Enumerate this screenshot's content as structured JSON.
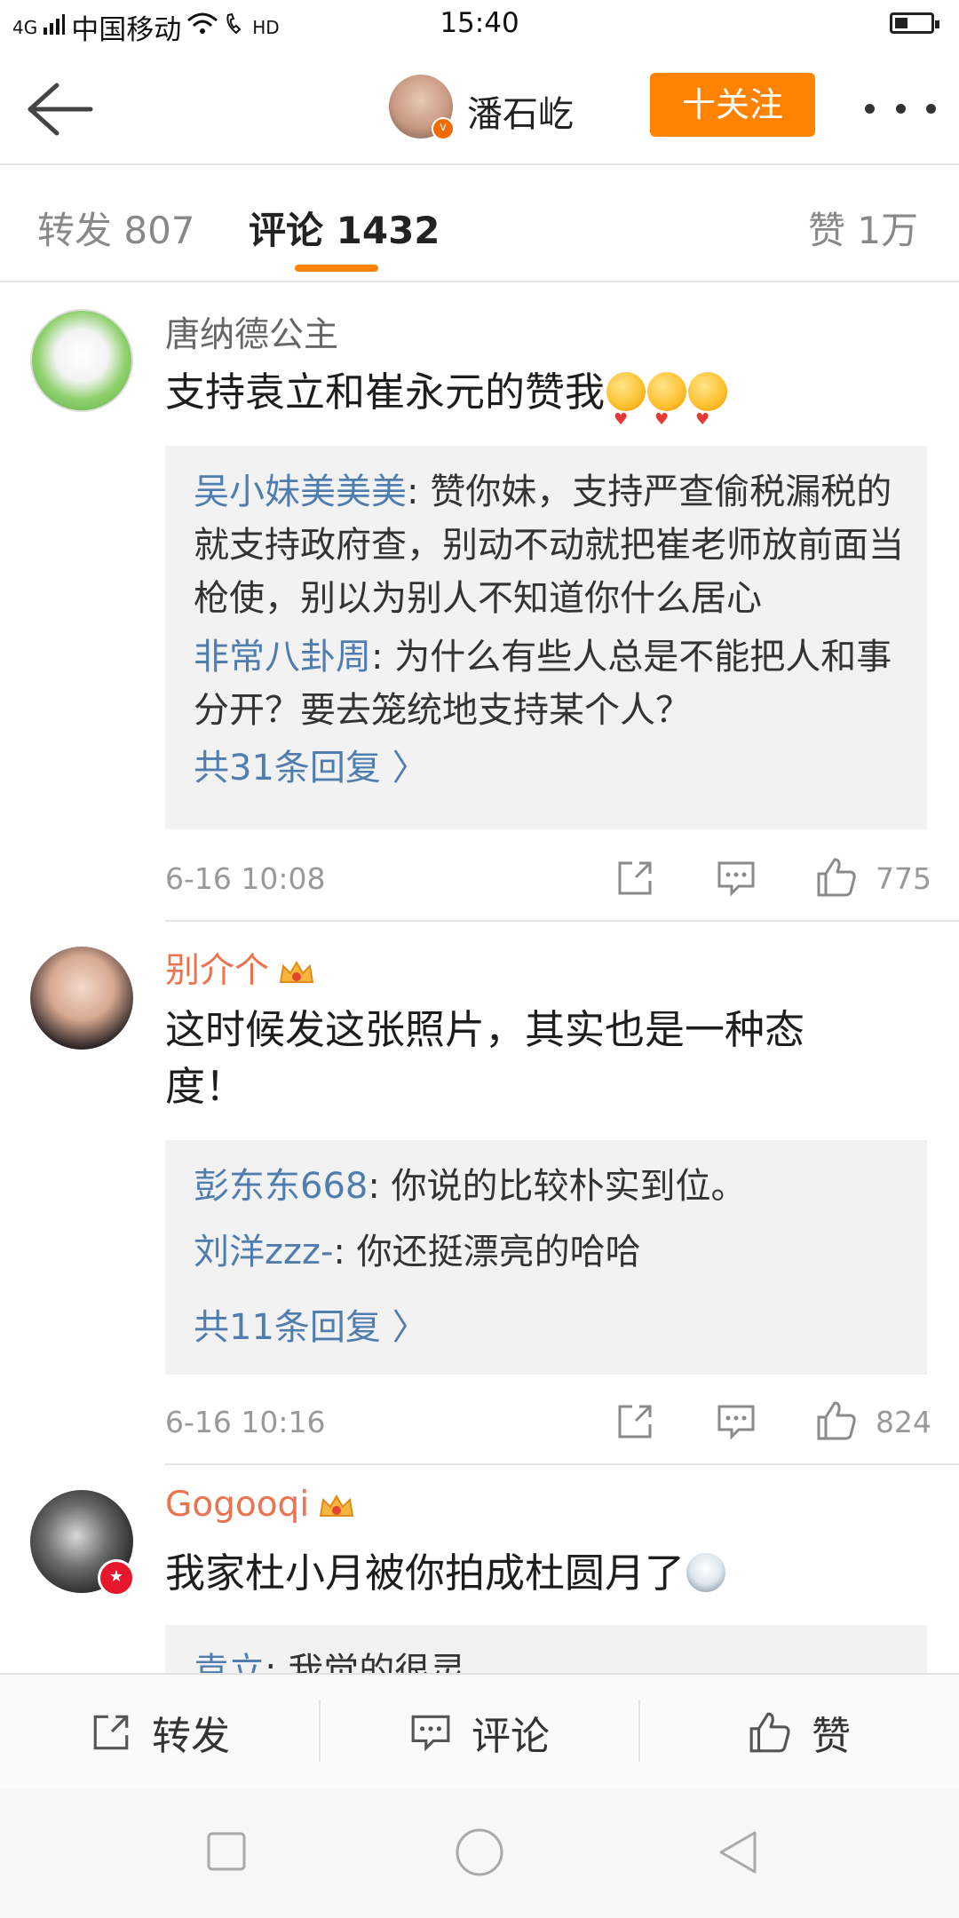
{
  "status_bar": {
    "network": "4G",
    "carrier": "中国移动",
    "hd": "HD",
    "time": "15:40"
  },
  "header": {
    "user_name": "潘石屹",
    "follow_label": "十关注"
  },
  "tabs": [
    {
      "label": "转发 807"
    },
    {
      "label": "评论 1432"
    },
    {
      "label": "赞 1万"
    }
  ],
  "comments": [
    {
      "user": "唐纳德公主",
      "text": "支持袁立和崔永元的赞我",
      "replies": [
        {
          "name": "吴小妹美美美",
          "text": ": 赞你妹，支持严查偷税漏税的就支持政府查，别动不动就把崔老师放前面当枪使，别以为别人不知道你什么居心"
        },
        {
          "name": "非常八卦周",
          "text": ": 为什么有些人总是不能把人和事分开？要去笼统地支持某个人？"
        }
      ],
      "more_replies": "共31条回复 〉",
      "time": "6-16 10:08",
      "likes": "775"
    },
    {
      "user": "别介个",
      "text": "这时候发这张照片，其实也是一种态度！",
      "replies": [
        {
          "name": "彭东东668",
          "text": ": 你说的比较朴实到位。"
        },
        {
          "name": "刘洋zzz-",
          "text": ": 你还挺漂亮的哈哈"
        }
      ],
      "more_replies": "共11条回复 〉",
      "time": "6-16 10:16",
      "likes": "824"
    },
    {
      "user": "Gogooqi",
      "text": "我家杜小月被你拍成杜圆月了",
      "replies": [
        {
          "name": "袁立",
          "text": ": 我觉的很灵"
        }
      ]
    }
  ],
  "bottom_bar": {
    "repost": "转发",
    "comment": "评论",
    "like": "赞"
  },
  "colors": {
    "accent": "#ff8200",
    "link": "#507daf",
    "vip_name": "#eb7350"
  }
}
